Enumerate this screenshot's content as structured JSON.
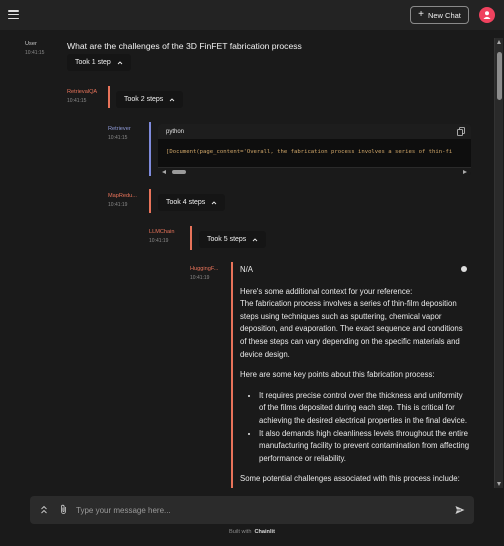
{
  "header": {
    "new_chat_label": "New Chat"
  },
  "messages": {
    "user": {
      "author": "User",
      "time": "10:41:15",
      "text": "What are the challenges of the 3D FinFET fabrication process",
      "steps": "Took 1 step"
    },
    "retrieval_qa": {
      "author": "RetrievalQA",
      "time": "10:41:15",
      "steps": "Took 2 steps"
    },
    "retriever": {
      "author": "Retriever",
      "time": "10:41:15",
      "code_lang": "python",
      "code_text": "[Document(page_content='Overall, the fabrication process involves a series of thin-fi"
    },
    "map_reduce": {
      "author": "MapRedu...",
      "time": "10:41:19",
      "steps": "Took 4 steps"
    },
    "llm_chain": {
      "author": "LLMChain",
      "time": "10:41:19",
      "steps": "Took 5 steps"
    },
    "hugging": {
      "author": "HuggingF...",
      "time": "10:41:19",
      "na": "N/A",
      "para1": "Here's some additional context for your reference:\nThe fabrication process involves a series of thin-film deposition steps using techniques such as sputtering, chemical vapor deposition, and evaporation. The exact sequence and conditions of these steps can vary depending on the specific materials and device design.",
      "para2": "Here are some key points about this fabrication process:",
      "bullets": [
        "It requires precise control over the thickness and uniformity of the films deposited during each step. This is critical for achieving the desired electrical properties in the final device.",
        "It also demands high cleanliness levels throughout the entire manufacturing facility to prevent contamination from affecting performance or reliability."
      ],
      "para3": "Some potential challenges associated with this process include:"
    }
  },
  "composer": {
    "placeholder": "Type your message here..."
  },
  "footer": {
    "built_with": "Built with",
    "brand": "Chainlit"
  },
  "colors": {
    "accent": "#f0425e",
    "tool_name": "#e8735a",
    "retriever_name": "#8f9ad8"
  }
}
